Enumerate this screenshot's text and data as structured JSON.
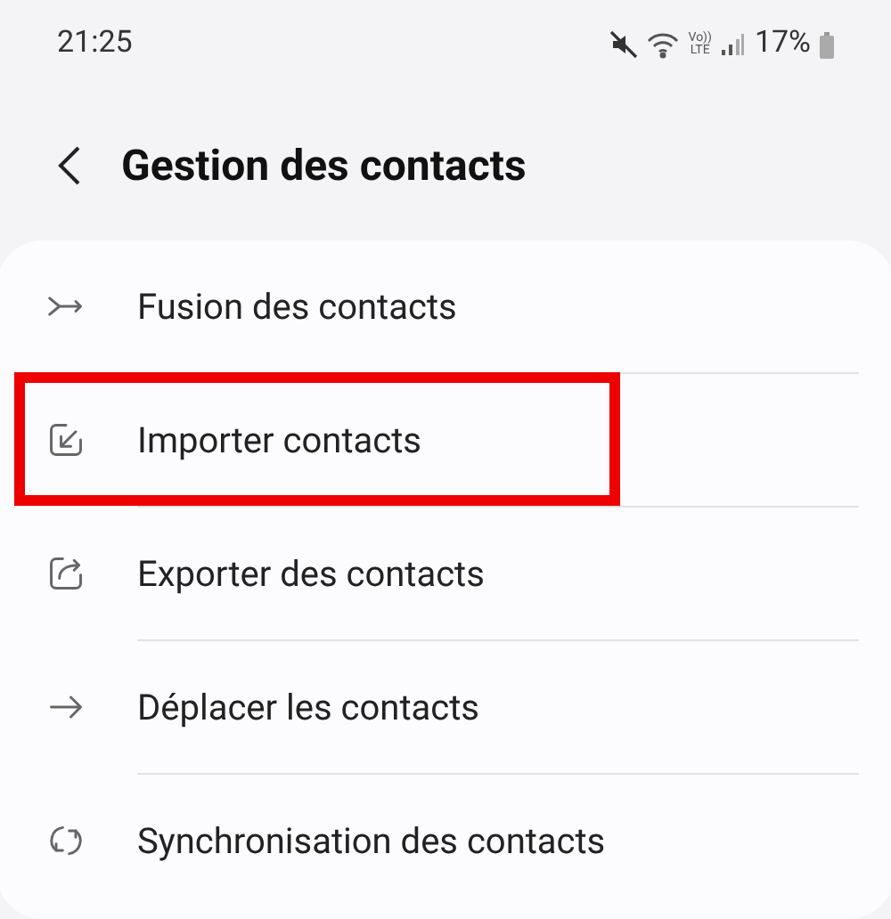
{
  "status_bar": {
    "time": "21:25",
    "network_top": "Vo))",
    "network_bottom": "LTE",
    "battery": "17%"
  },
  "header": {
    "title": "Gestion des contacts"
  },
  "items": [
    {
      "kind": "merge",
      "label": "Fusion des contacts",
      "highlighted": false
    },
    {
      "kind": "import",
      "label": "Importer contacts",
      "highlighted": true
    },
    {
      "kind": "export",
      "label": "Exporter des contacts",
      "highlighted": false
    },
    {
      "kind": "move",
      "label": "Déplacer les contacts",
      "highlighted": false
    },
    {
      "kind": "sync",
      "label": "Synchronisation des contacts",
      "highlighted": false
    }
  ]
}
